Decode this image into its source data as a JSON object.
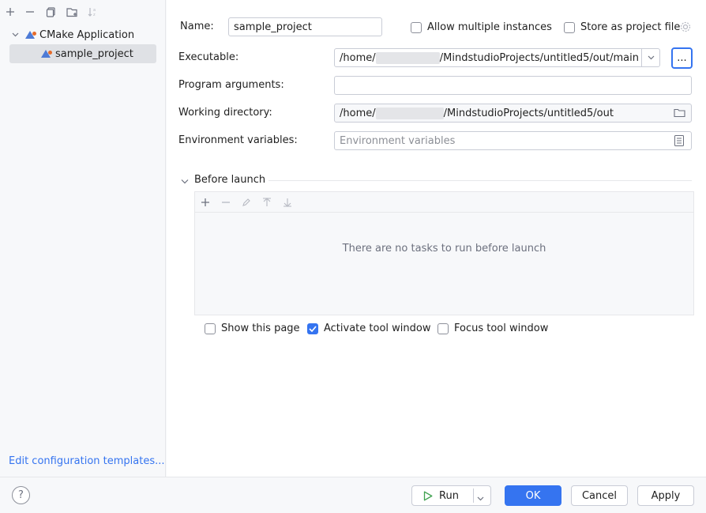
{
  "toolbar": {
    "icons": [
      "add-icon",
      "remove-icon",
      "copy-icon",
      "new-folder-icon",
      "sort-icon"
    ]
  },
  "tree": {
    "group_label": "CMake Application",
    "item_label": "sample_project"
  },
  "left_footer": {
    "edit_templates": "Edit configuration templates..."
  },
  "form": {
    "name_label": "Name:",
    "name_value": "sample_project",
    "allow_multiple_label": "Allow multiple instances",
    "allow_multiple_checked": false,
    "store_project_label": "Store as project file",
    "store_project_checked": false,
    "executable_label": "Executable:",
    "executable_prefix": "/home/",
    "executable_suffix": "/MindstudioProjects/untitled5/out/main",
    "browse_label": "...",
    "program_args_label": "Program arguments:",
    "program_args_value": "",
    "working_dir_label": "Working directory:",
    "working_dir_prefix": "/home/",
    "working_dir_suffix": "/MindstudioProjects/untitled5/out",
    "env_vars_label": "Environment variables:",
    "env_vars_placeholder": "Environment variables"
  },
  "before_launch": {
    "title": "Before launch",
    "empty_text": "There are no tasks to run before launch",
    "show_page_label": "Show this page",
    "show_page_checked": false,
    "activate_tool_label": "Activate tool window",
    "activate_tool_checked": true,
    "focus_tool_label": "Focus tool window",
    "focus_tool_checked": false
  },
  "buttons": {
    "help": "?",
    "run": "Run",
    "ok": "OK",
    "cancel": "Cancel",
    "apply": "Apply"
  },
  "colors": {
    "accent": "#3574f0",
    "background": "#f7f8fa"
  }
}
